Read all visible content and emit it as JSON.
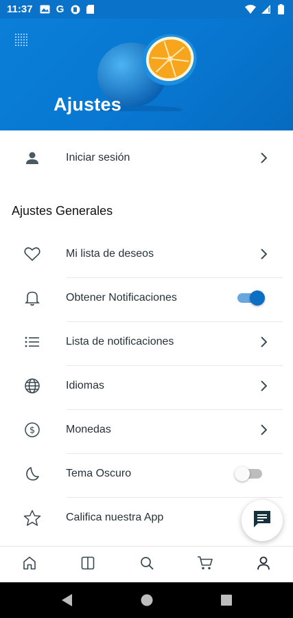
{
  "status_bar": {
    "time": "11:37",
    "left_icons": [
      "image-icon",
      "google-icon",
      "cast-icon",
      "sd-card-icon"
    ],
    "right_icons": [
      "wifi-icon",
      "signal-icon",
      "battery-icon"
    ]
  },
  "header": {
    "title": "Ajustes",
    "menu_icon": "grid-dots-icon",
    "background_color": "#0a7fd8"
  },
  "login": {
    "icon": "person-icon",
    "label": "Iniciar sesión"
  },
  "general_settings": {
    "section_title": "Ajustes Generales",
    "items": [
      {
        "icon": "heart-icon",
        "label": "Mi lista de deseos",
        "control": "chevron"
      },
      {
        "icon": "bell-icon",
        "label": "Obtener Notificaciones",
        "control": "toggle",
        "toggle_on": true
      },
      {
        "icon": "list-icon",
        "label": "Lista de notificaciones",
        "control": "chevron"
      },
      {
        "icon": "globe-icon",
        "label": "Idiomas",
        "control": "chevron"
      },
      {
        "icon": "dollar-circle-icon",
        "label": "Monedas",
        "control": "chevron"
      },
      {
        "icon": "moon-icon",
        "label": "Tema Oscuro",
        "control": "toggle",
        "toggle_on": false
      },
      {
        "icon": "star-icon",
        "label": "Califica nuestra App",
        "control": "none"
      }
    ]
  },
  "fab": {
    "icon": "chat-icon"
  },
  "bottom_nav": {
    "items": [
      {
        "icon": "home-icon"
      },
      {
        "icon": "categories-icon"
      },
      {
        "icon": "search-icon"
      },
      {
        "icon": "cart-icon"
      },
      {
        "icon": "account-icon",
        "active": true
      }
    ]
  },
  "system_nav": {
    "items": [
      "back-icon",
      "home-circle-icon",
      "recents-icon"
    ]
  },
  "colors": {
    "accent": "#0b6fc4",
    "icon": "#37474f",
    "toggle_on_track": "#6aa6de"
  }
}
